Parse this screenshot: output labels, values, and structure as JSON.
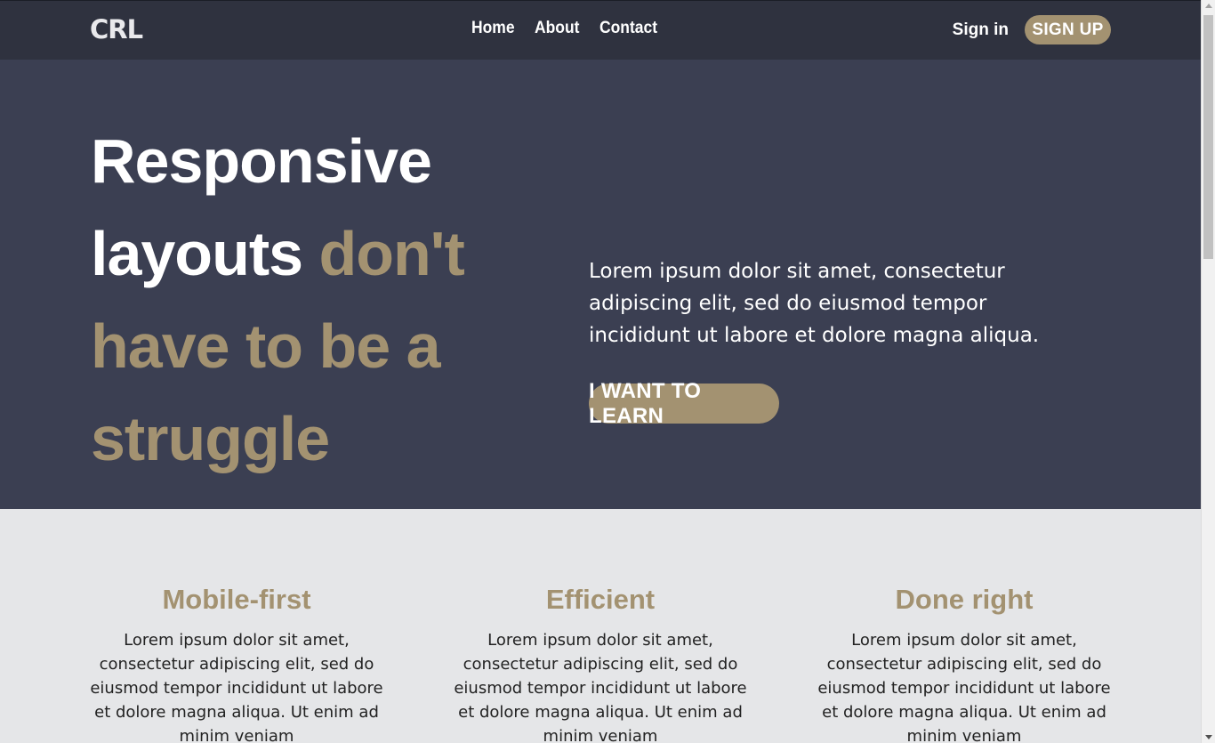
{
  "navbar": {
    "logo": "CRL",
    "links": [
      "Home",
      "About",
      "Contact"
    ],
    "signin": "Sign in",
    "signup": "SIGN UP"
  },
  "hero": {
    "title_white": "Responsive layouts",
    "title_accent": "don't have to be a struggle",
    "text": "Lorem ipsum dolor sit amet, consectetur adipiscing elit, sed do eiusmod tempor incididunt ut labore et dolore magna aliqua.",
    "button": "I WANT TO LEARN"
  },
  "features": [
    {
      "title": "Mobile-first",
      "text": "Lorem ipsum dolor sit amet, consectetur adipiscing elit, sed do eiusmod tempor incididunt ut labore et dolore magna aliqua. Ut enim ad minim veniam"
    },
    {
      "title": "Efficient",
      "text": "Lorem ipsum dolor sit amet, consectetur adipiscing elit, sed do eiusmod tempor incididunt ut labore et dolore magna aliqua. Ut enim ad minim veniam"
    },
    {
      "title": "Done right",
      "text": "Lorem ipsum dolor sit amet, consectetur adipiscing elit, sed do eiusmod tempor incididunt ut labore et dolore magna aliqua. Ut enim ad minim veniam"
    }
  ],
  "colors": {
    "accent": "#a39271",
    "nav_bg": "#2f323f",
    "hero_bg": "#3b3f52",
    "page_bg": "#e5e6e8"
  }
}
